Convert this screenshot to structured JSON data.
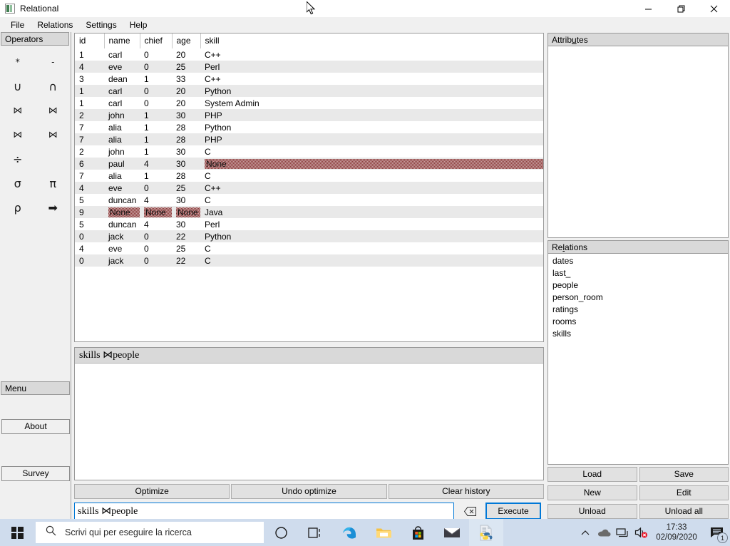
{
  "window": {
    "title": "Relational",
    "icon": "app-icon",
    "controls": {
      "minimize": "minimize-icon",
      "restore": "restore-icon",
      "close": "close-icon"
    }
  },
  "menubar": {
    "items": [
      "File",
      "Relations",
      "Settings",
      "Help"
    ]
  },
  "sidebar": {
    "operators_header": "Operators",
    "operators": [
      {
        "symbol": "*",
        "name": "product-operator"
      },
      {
        "symbol": "-",
        "name": "difference-operator"
      },
      {
        "symbol": "∪",
        "name": "union-operator"
      },
      {
        "symbol": "∩",
        "name": "intersection-operator"
      },
      {
        "symbol": "⋈",
        "name": "natural-join-operator"
      },
      {
        "symbol": "⋈",
        "name": "outer-join-operator"
      },
      {
        "symbol": "⋈",
        "name": "left-outer-join-operator"
      },
      {
        "symbol": "⋈",
        "name": "right-outer-join-operator"
      },
      {
        "symbol": "÷",
        "name": "division-operator"
      },
      {
        "symbol": "",
        "name": "empty-operator-slot"
      },
      {
        "symbol": "σ",
        "name": "selection-operator"
      },
      {
        "symbol": "π",
        "name": "projection-operator"
      },
      {
        "symbol": "ρ",
        "name": "rename-operator"
      },
      {
        "symbol": "➡",
        "name": "arrow-operator"
      }
    ],
    "menu_header": "Menu",
    "about_label": "About",
    "survey_label": "Survey"
  },
  "result_table": {
    "columns": [
      "id",
      "name",
      "chief",
      "age",
      "skill"
    ],
    "rows": [
      {
        "id": "1",
        "name": "carl",
        "chief": "0",
        "age": "20",
        "skill": "C++"
      },
      {
        "id": "4",
        "name": "eve",
        "chief": "0",
        "age": "25",
        "skill": "Perl"
      },
      {
        "id": "3",
        "name": "dean",
        "chief": "1",
        "age": "33",
        "skill": "C++"
      },
      {
        "id": "1",
        "name": "carl",
        "chief": "0",
        "age": "20",
        "skill": "Python"
      },
      {
        "id": "1",
        "name": "carl",
        "chief": "0",
        "age": "20",
        "skill": "System Admin"
      },
      {
        "id": "2",
        "name": "john",
        "chief": "1",
        "age": "30",
        "skill": "PHP"
      },
      {
        "id": "7",
        "name": "alia",
        "chief": "1",
        "age": "28",
        "skill": "Python"
      },
      {
        "id": "7",
        "name": "alia",
        "chief": "1",
        "age": "28",
        "skill": "PHP"
      },
      {
        "id": "2",
        "name": "john",
        "chief": "1",
        "age": "30",
        "skill": "C"
      },
      {
        "id": "6",
        "name": "paul",
        "chief": "4",
        "age": "30",
        "skill": "None"
      },
      {
        "id": "7",
        "name": "alia",
        "chief": "1",
        "age": "28",
        "skill": "C"
      },
      {
        "id": "4",
        "name": "eve",
        "chief": "0",
        "age": "25",
        "skill": "C++"
      },
      {
        "id": "5",
        "name": "duncan",
        "chief": "4",
        "age": "30",
        "skill": "C"
      },
      {
        "id": "9",
        "name": "None",
        "chief": "None",
        "age": "None",
        "skill": "Java"
      },
      {
        "id": "5",
        "name": "duncan",
        "chief": "4",
        "age": "30",
        "skill": "Perl"
      },
      {
        "id": "0",
        "name": "jack",
        "chief": "0",
        "age": "22",
        "skill": "Python"
      },
      {
        "id": "4",
        "name": "eve",
        "chief": "0",
        "age": "25",
        "skill": "C"
      },
      {
        "id": "0",
        "name": "jack",
        "chief": "0",
        "age": "22",
        "skill": "C"
      }
    ]
  },
  "history": {
    "entry": "skills ⋈people"
  },
  "actions": {
    "optimize": "Optimize",
    "undo_optimize": "Undo optimize",
    "clear_history": "Clear history"
  },
  "query": {
    "value": "skills ⋈people",
    "clear_icon": "clear-input-icon",
    "execute_label": "Execute"
  },
  "attributes": {
    "header": "Attributes",
    "header_accel": "u",
    "items": []
  },
  "relations": {
    "header": "Relations",
    "header_accel": "l",
    "items": [
      "dates",
      "last_",
      "people",
      "person_room",
      "ratings",
      "rooms",
      "skills"
    ]
  },
  "relation_buttons": [
    "Load",
    "Save",
    "New",
    "Edit",
    "Unload",
    "Unload all"
  ],
  "taskbar": {
    "start": "windows-start-icon",
    "search_placeholder": "Scrivi qui per eseguire la ricerca",
    "search_icon": "search-icon",
    "icons": [
      "cortana-icon",
      "task-view-icon",
      "edge-icon",
      "file-explorer-icon",
      "microsoft-store-icon",
      "mail-icon",
      "python-file-icon"
    ],
    "tray": [
      "show-hidden-icons-chevron",
      "onedrive-icon",
      "network-icon",
      "volume-muted-icon"
    ],
    "time": "17:33",
    "date": "02/09/2020",
    "notification_count": "1"
  },
  "colors": {
    "accent": "#0078d7",
    "numeric_text": "#1414d2",
    "none_highlight": "#8b3a3a",
    "panel_header": "#d9d9d9",
    "taskbar": "#cfdced"
  }
}
